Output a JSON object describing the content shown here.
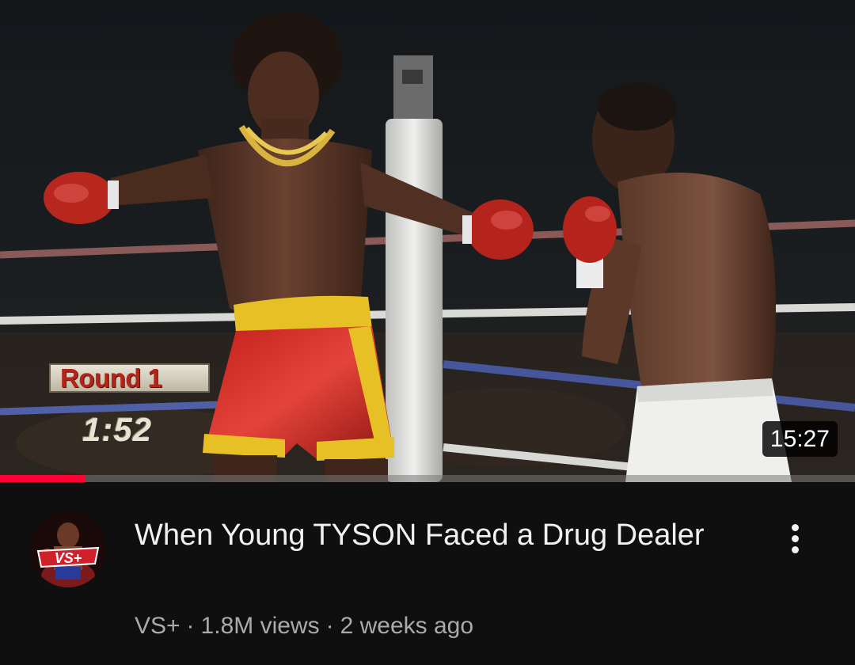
{
  "video": {
    "duration": "15:27",
    "progress_fraction": 0.1,
    "overlay_round": "Round 1",
    "overlay_clock": "1:52",
    "title": "When Young TYSON Faced a Drug Dealer",
    "channel": "VS+",
    "views": "1.8M views",
    "published": "2 weeks ago",
    "separator": "·"
  },
  "channel_avatar": {
    "logo_text": "VS+"
  },
  "icons": {
    "more": "more-vertical-icon"
  },
  "colors": {
    "background": "#0f0f0f",
    "title": "#f1f1f1",
    "meta": "#aaaaaa",
    "progress": "#ff0033",
    "logo_red": "#d0202a"
  }
}
